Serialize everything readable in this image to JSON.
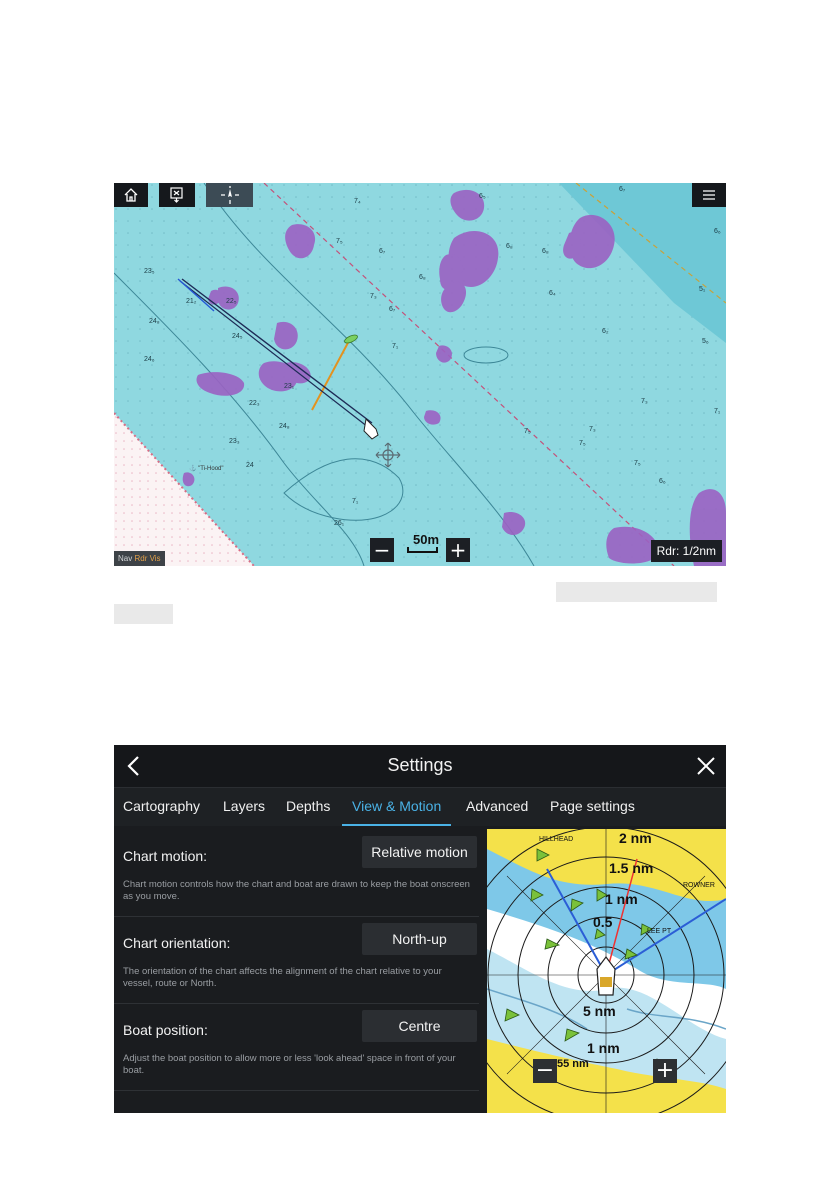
{
  "chart_screen": {
    "toolbar": {
      "home_icon": "home-icon",
      "waypoint_icon": "drop-waypoint-icon",
      "find_ship_icon": "find-ship-icon",
      "menu_icon": "hamburger-menu-icon"
    },
    "zoom": {
      "minus": "−",
      "plus": "+",
      "scale": "50m"
    },
    "radar_range": "Rdr: 1/2nm",
    "source_badge": {
      "label": "Nav",
      "value": "Rdr Vis"
    },
    "depth_soundings": [
      "23₅",
      "24₈",
      "21₂",
      "22₅",
      "24₅",
      "24₆",
      "23₁",
      "22₃",
      "23₃",
      "24",
      "26₁",
      "7₄",
      "6₇",
      "7₃",
      "7₁",
      "6₅",
      "6₈",
      "6₄",
      "6₂",
      "5₆",
      "7₅",
      "6₆"
    ],
    "colors": {
      "water": "#8fd8e0",
      "land": "#fbf3f4",
      "radar_overlay": "#9b62c3",
      "track": "#1d2b56",
      "heading_line": "#e3921f"
    }
  },
  "settings_screen": {
    "title": "Settings",
    "back_icon": "chevron-left-icon",
    "close_icon": "close-icon",
    "tabs": [
      {
        "label": "Cartography"
      },
      {
        "label": "Layers"
      },
      {
        "label": "Depths"
      },
      {
        "label": "View & Motion",
        "active": true
      },
      {
        "label": "Advanced"
      },
      {
        "label": "Page settings"
      }
    ],
    "rows": [
      {
        "label": "Chart motion:",
        "value": "Relative motion",
        "description": "Chart motion controls how the chart and boat are drawn to keep the boat onscreen as you move."
      },
      {
        "label": "Chart orientation:",
        "value": "North-up",
        "description": "The orientation of the chart affects the alignment of the chart relative to your vessel, route or North."
      },
      {
        "label": "Boat position:",
        "value": "Centre",
        "description": "Adjust the boat position to allow more or less 'look ahead' space in front of your boat."
      }
    ],
    "preview": {
      "range_labels": [
        "2 nm",
        "1.5 nm",
        "1 nm",
        "0.5",
        "5 nm",
        "1 nm"
      ],
      "place_labels": [
        "HILLHEAD",
        "ROWNER",
        "LEE PT"
      ],
      "zoom_minus": "−",
      "zoom_plus": "+",
      "scale": "55 nm"
    },
    "colors": {
      "accent": "#4ab2e6",
      "background": "#1a1c1f",
      "land": "#f4e14a",
      "shallow": "#7ec8e8"
    }
  }
}
